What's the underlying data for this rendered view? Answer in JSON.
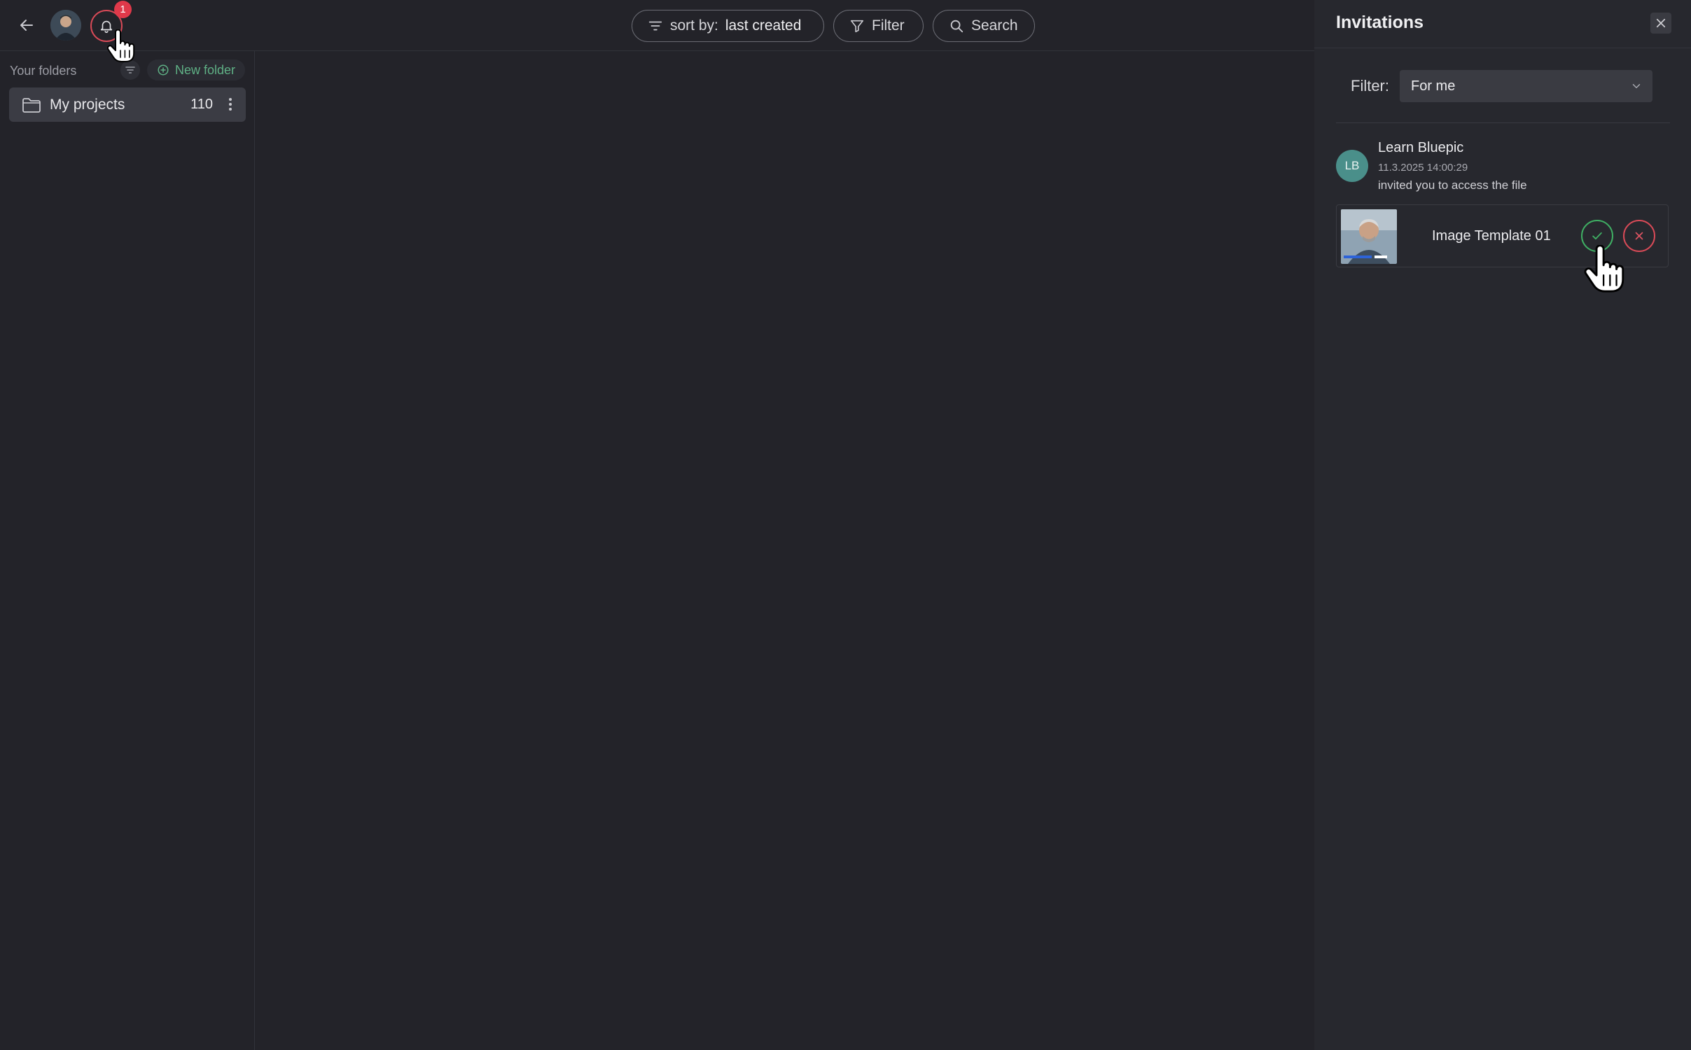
{
  "topbar": {
    "notification_count": "1",
    "sort": {
      "label": "sort by:",
      "value": "last created"
    },
    "filter_label": "Filter",
    "search_label": "Search"
  },
  "sidebar": {
    "folders_label": "Your folders",
    "new_folder_label": "New folder",
    "folders": [
      {
        "name": "My projects",
        "count": "110"
      }
    ]
  },
  "invitations": {
    "title": "Invitations",
    "filter": {
      "label": "Filter:",
      "value": "For me"
    },
    "items": [
      {
        "initials": "LB",
        "sender": "Learn Bluepic",
        "timestamp": "11.3.2025 14:00:29",
        "message": "invited you to access the file",
        "file_name": "Image Template 01"
      }
    ]
  },
  "colors": {
    "background": "#232329",
    "panel": "#27282e",
    "accent_green": "#3fae63",
    "accent_red": "#d84a57",
    "avatar_teal": "#4a8f8a"
  },
  "icons": [
    "arrow-left-icon",
    "bell-icon",
    "sort-lines-icon",
    "funnel-icon",
    "search-icon",
    "plus-circle-icon",
    "folder-icon",
    "more-vertical-icon",
    "close-icon",
    "chevron-down-icon",
    "check-icon",
    "x-icon",
    "hand-pointer-icon"
  ]
}
